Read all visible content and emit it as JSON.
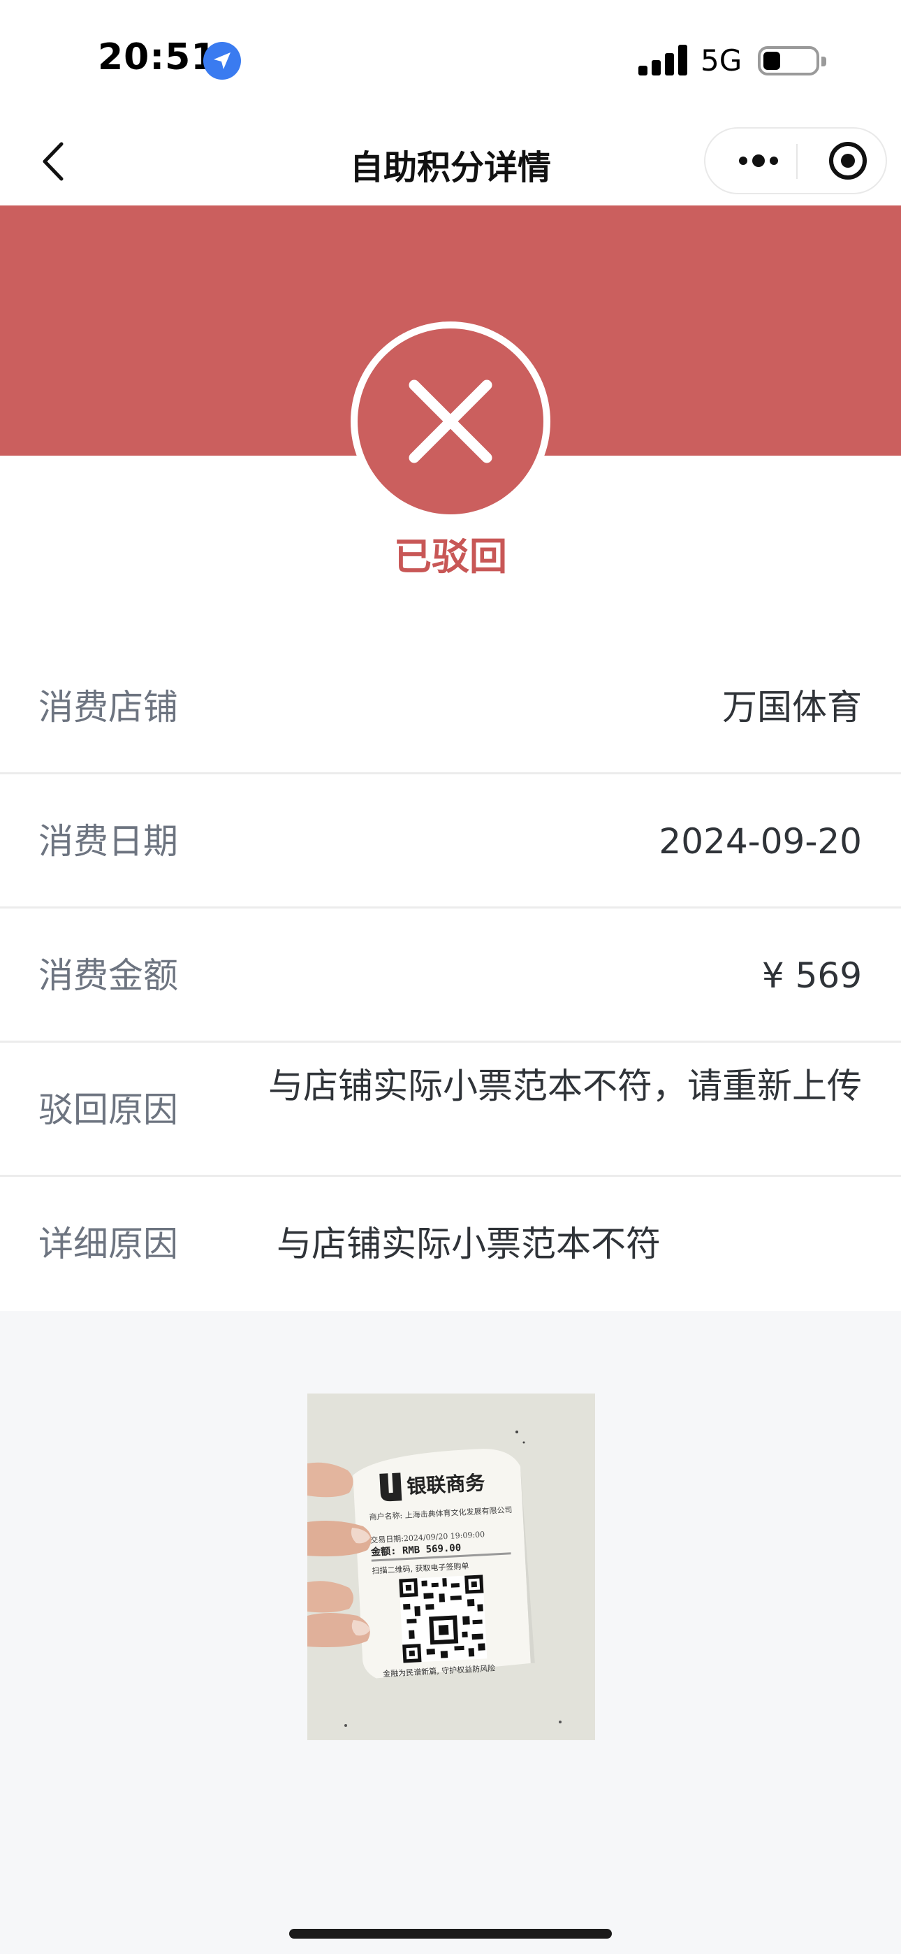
{
  "status_bar": {
    "time": "20:51",
    "network": "5G"
  },
  "nav": {
    "title": "自助积分详情"
  },
  "status": {
    "text": "已驳回",
    "color": "#cb5f5e"
  },
  "details": [
    {
      "label": "消费店铺",
      "value": "万国体育"
    },
    {
      "label": "消费日期",
      "value": "2024-09-20"
    },
    {
      "label": "消费金额",
      "value": "¥ 569"
    },
    {
      "label": "驳回原因",
      "value": "与店铺实际小票范本不符，请重新上传"
    },
    {
      "label": "详细原因",
      "value": "与店铺实际小票范本不符"
    }
  ],
  "receipt": {
    "brand": "银联商务",
    "merchant": "商户名称: 上海击典体育文化发展有限公司",
    "trade_date": "交易日期:2024/09/20 19:09:00",
    "amount": "金额: RMB 569.00",
    "scan_hint": "扫描二维码, 获取电子签购单",
    "footer": "金融为民谱新篇, 守护权益防风险"
  }
}
